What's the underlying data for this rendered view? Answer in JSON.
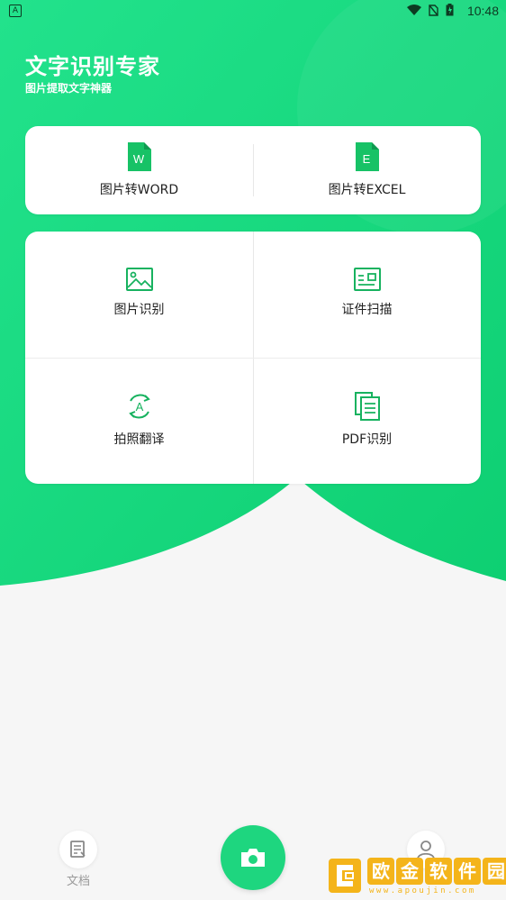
{
  "status_bar": {
    "time": "10:48",
    "notification_glyph": "A"
  },
  "header": {
    "title": "文字识别专家",
    "subtitle": "图片提取文字神器"
  },
  "top_card": {
    "items": [
      {
        "label": "图片转WORD",
        "icon": "word-file-icon",
        "icon_letter": "W"
      },
      {
        "label": "图片转EXCEL",
        "icon": "excel-file-icon",
        "icon_letter": "E"
      }
    ]
  },
  "grid_card": {
    "items": [
      {
        "label": "图片识别",
        "icon": "image-icon"
      },
      {
        "label": "证件扫描",
        "icon": "id-card-icon"
      },
      {
        "label": "拍照翻译",
        "icon": "translate-icon",
        "icon_letter": "A"
      },
      {
        "label": "PDF识别",
        "icon": "documents-icon"
      }
    ]
  },
  "bottom_nav": {
    "documents_label": "文档",
    "camera_icon": "camera-icon",
    "profile_icon": "user-icon"
  },
  "watermark": {
    "chars": [
      "欧",
      "金",
      "软",
      "件",
      "园"
    ],
    "url": "www.apoujin.com"
  },
  "colors": {
    "accent": "#1ed67f",
    "accent_dark": "#0fc870",
    "icon_green": "#17b25f"
  }
}
